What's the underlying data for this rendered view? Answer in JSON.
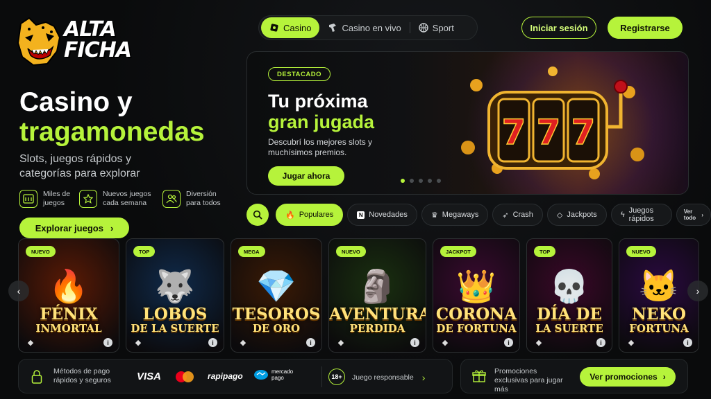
{
  "brand": {
    "logo_text_1": "ALTA",
    "logo_text_2": "FICHA",
    "accent": "#b6f33b"
  },
  "nav": {
    "items": [
      {
        "label": "Casino",
        "icon": "casino-chip-icon",
        "active": true
      },
      {
        "label": "Casino en vivo",
        "icon": "live-dealer-icon",
        "active": false
      },
      {
        "label": "Sport",
        "icon": "basketball-icon",
        "active": false
      }
    ],
    "login_label": "Iniciar sesión",
    "register_label": "Registrarse"
  },
  "hero": {
    "title_line1": "Casino y",
    "title_line2": "tragamonedas",
    "subtitle": "Slots, juegos rápidos y categorías para explorar",
    "features": [
      {
        "icon": "slot-machine-icon",
        "text": "Miles de juegos"
      },
      {
        "icon": "star-icon",
        "text": "Nuevos juegos cada semana"
      },
      {
        "icon": "users-icon",
        "text": "Diversión para todos"
      }
    ],
    "explore_label": "Explorar juegos"
  },
  "banner": {
    "badge": "DESTACADO",
    "title_line1": "Tu próxima",
    "title_line2": "gran jugada",
    "subtitle": "Descubrí los mejores slots y muchísimos premios.",
    "cta_label": "Jugar ahora",
    "slot_symbols": [
      "7",
      "7",
      "7"
    ],
    "dots_count": 5,
    "active_dot": 0
  },
  "filters": {
    "chips": [
      {
        "label": "Populares",
        "icon": "flame-icon",
        "active": true
      },
      {
        "label": "Novedades",
        "icon": "new-icon",
        "active": false
      },
      {
        "label": "Megaways",
        "icon": "crown-icon",
        "active": false
      },
      {
        "label": "Crash",
        "icon": "rocket-icon",
        "active": false
      },
      {
        "label": "Jackpots",
        "icon": "diamond-icon",
        "active": false
      },
      {
        "label": "Juegos rápidos",
        "icon": "bolt-icon",
        "active": false
      }
    ],
    "see_all_label": "Ver todo"
  },
  "games": [
    {
      "tag": "NUEVO",
      "line1": "FÉNIX",
      "line2": "INMORTAL",
      "art": "🔥",
      "bg": "#5a1a05"
    },
    {
      "tag": "TOP",
      "line1": "LOBOS",
      "line2": "DE LA SUERTE",
      "art": "🐺",
      "bg": "#0f2a4a"
    },
    {
      "tag": "MEGA",
      "line1": "TESOROS",
      "line2": "DE ORO",
      "art": "💎",
      "bg": "#3a1a05"
    },
    {
      "tag": "NUEVO",
      "line1": "AVENTURA",
      "line2": "PERDIDA",
      "art": "🗿",
      "bg": "#1a3010"
    },
    {
      "tag": "JACKPOT",
      "line1": "CORONA",
      "line2": "DE FORTUNA",
      "art": "👑",
      "bg": "#3a0a30"
    },
    {
      "tag": "TOP",
      "line1": "DÍA DE",
      "line2": "LA SUERTE",
      "art": "💀",
      "bg": "#3a0828"
    },
    {
      "tag": "NUEVO",
      "line1": "NEKO",
      "line2": "FORTUNA",
      "art": "🐱",
      "bg": "#2a0a40"
    }
  ],
  "footer": {
    "payments_text": "Métodos de pago rápidos y seguros",
    "payment_brands": [
      "VISA",
      "mastercard",
      "rapipago",
      "mercado pago"
    ],
    "responsible_badge": "18+",
    "responsible_text": "Juego responsable",
    "promo_text": "Promociones exclusivas para jugar más",
    "promo_button": "Ver promociones"
  }
}
